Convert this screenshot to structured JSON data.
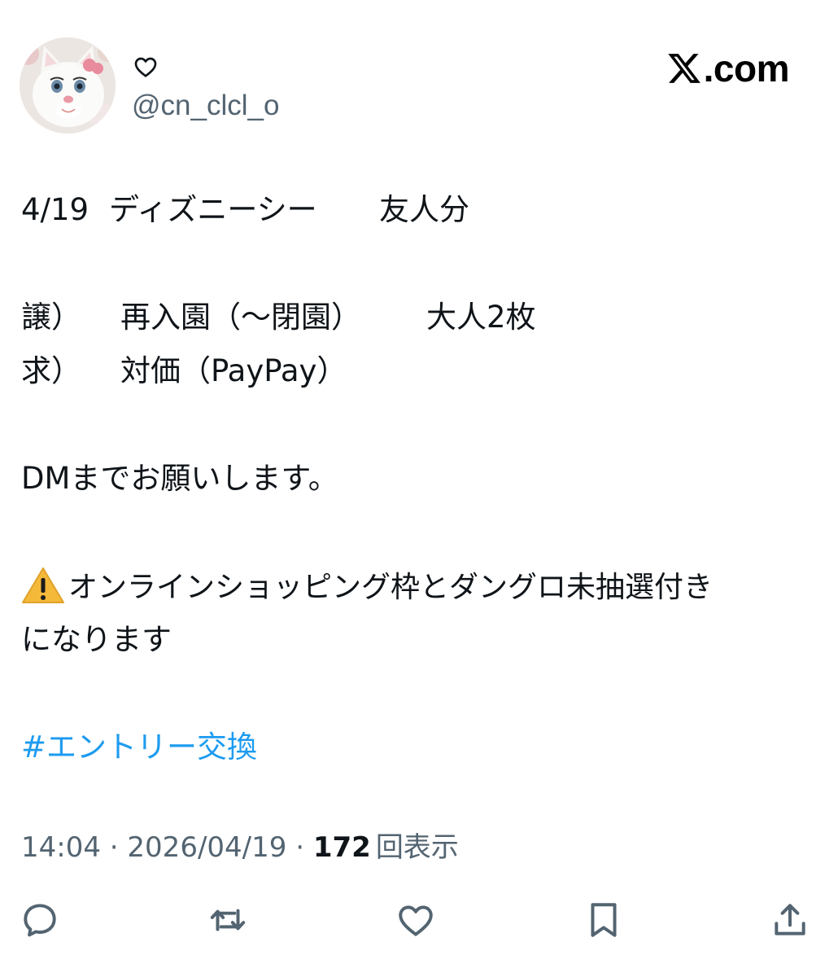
{
  "user": {
    "handle": "@cn_clcl_o",
    "display_name_icon": "heart-icon",
    "avatar_icon": "white-cat-avatar"
  },
  "brand": {
    "logo_icon": "x-logo-icon",
    "text": ".com"
  },
  "post": {
    "line1": {
      "date": "4/19",
      "park": "ディズニーシー",
      "who": "友人分"
    },
    "offer": {
      "label": "譲）",
      "item": "再入園（〜閉園）",
      "count": "大人2枚"
    },
    "want": {
      "label": "求）",
      "item": "対価（PayPay）"
    },
    "dm": "DMまでお願いします。",
    "warning_icon": "warning-icon",
    "note_line1": "オンラインショッピング枠とダングロ未抽選付き",
    "note_line2": "になります",
    "hashtag": "#エントリー交換"
  },
  "meta": {
    "time": "14:04",
    "separator": " · ",
    "date": "2026/04/19",
    "views_count": "172",
    "views_label": "回表示"
  },
  "actions": {
    "reply_icon": "reply-icon",
    "repost_icon": "repost-icon",
    "like_icon": "like-icon",
    "bookmark_icon": "bookmark-icon",
    "share_icon": "share-icon"
  }
}
